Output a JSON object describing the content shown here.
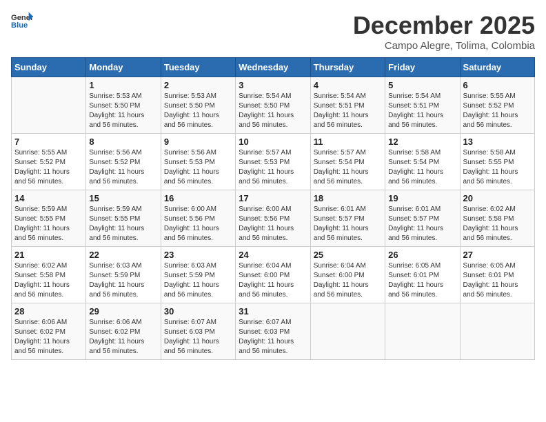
{
  "header": {
    "logo_general": "General",
    "logo_blue": "Blue",
    "month_title": "December 2025",
    "subtitle": "Campo Alegre, Tolima, Colombia"
  },
  "calendar": {
    "days_of_week": [
      "Sunday",
      "Monday",
      "Tuesday",
      "Wednesday",
      "Thursday",
      "Friday",
      "Saturday"
    ],
    "weeks": [
      [
        {
          "day": "",
          "info": ""
        },
        {
          "day": "1",
          "info": "Sunrise: 5:53 AM\nSunset: 5:50 PM\nDaylight: 11 hours\nand 56 minutes."
        },
        {
          "day": "2",
          "info": "Sunrise: 5:53 AM\nSunset: 5:50 PM\nDaylight: 11 hours\nand 56 minutes."
        },
        {
          "day": "3",
          "info": "Sunrise: 5:54 AM\nSunset: 5:50 PM\nDaylight: 11 hours\nand 56 minutes."
        },
        {
          "day": "4",
          "info": "Sunrise: 5:54 AM\nSunset: 5:51 PM\nDaylight: 11 hours\nand 56 minutes."
        },
        {
          "day": "5",
          "info": "Sunrise: 5:54 AM\nSunset: 5:51 PM\nDaylight: 11 hours\nand 56 minutes."
        },
        {
          "day": "6",
          "info": "Sunrise: 5:55 AM\nSunset: 5:52 PM\nDaylight: 11 hours\nand 56 minutes."
        }
      ],
      [
        {
          "day": "7",
          "info": "Sunrise: 5:55 AM\nSunset: 5:52 PM\nDaylight: 11 hours\nand 56 minutes."
        },
        {
          "day": "8",
          "info": "Sunrise: 5:56 AM\nSunset: 5:52 PM\nDaylight: 11 hours\nand 56 minutes."
        },
        {
          "day": "9",
          "info": "Sunrise: 5:56 AM\nSunset: 5:53 PM\nDaylight: 11 hours\nand 56 minutes."
        },
        {
          "day": "10",
          "info": "Sunrise: 5:57 AM\nSunset: 5:53 PM\nDaylight: 11 hours\nand 56 minutes."
        },
        {
          "day": "11",
          "info": "Sunrise: 5:57 AM\nSunset: 5:54 PM\nDaylight: 11 hours\nand 56 minutes."
        },
        {
          "day": "12",
          "info": "Sunrise: 5:58 AM\nSunset: 5:54 PM\nDaylight: 11 hours\nand 56 minutes."
        },
        {
          "day": "13",
          "info": "Sunrise: 5:58 AM\nSunset: 5:55 PM\nDaylight: 11 hours\nand 56 minutes."
        }
      ],
      [
        {
          "day": "14",
          "info": "Sunrise: 5:59 AM\nSunset: 5:55 PM\nDaylight: 11 hours\nand 56 minutes."
        },
        {
          "day": "15",
          "info": "Sunrise: 5:59 AM\nSunset: 5:55 PM\nDaylight: 11 hours\nand 56 minutes."
        },
        {
          "day": "16",
          "info": "Sunrise: 6:00 AM\nSunset: 5:56 PM\nDaylight: 11 hours\nand 56 minutes."
        },
        {
          "day": "17",
          "info": "Sunrise: 6:00 AM\nSunset: 5:56 PM\nDaylight: 11 hours\nand 56 minutes."
        },
        {
          "day": "18",
          "info": "Sunrise: 6:01 AM\nSunset: 5:57 PM\nDaylight: 11 hours\nand 56 minutes."
        },
        {
          "day": "19",
          "info": "Sunrise: 6:01 AM\nSunset: 5:57 PM\nDaylight: 11 hours\nand 56 minutes."
        },
        {
          "day": "20",
          "info": "Sunrise: 6:02 AM\nSunset: 5:58 PM\nDaylight: 11 hours\nand 56 minutes."
        }
      ],
      [
        {
          "day": "21",
          "info": "Sunrise: 6:02 AM\nSunset: 5:58 PM\nDaylight: 11 hours\nand 56 minutes."
        },
        {
          "day": "22",
          "info": "Sunrise: 6:03 AM\nSunset: 5:59 PM\nDaylight: 11 hours\nand 56 minutes."
        },
        {
          "day": "23",
          "info": "Sunrise: 6:03 AM\nSunset: 5:59 PM\nDaylight: 11 hours\nand 56 minutes."
        },
        {
          "day": "24",
          "info": "Sunrise: 6:04 AM\nSunset: 6:00 PM\nDaylight: 11 hours\nand 56 minutes."
        },
        {
          "day": "25",
          "info": "Sunrise: 6:04 AM\nSunset: 6:00 PM\nDaylight: 11 hours\nand 56 minutes."
        },
        {
          "day": "26",
          "info": "Sunrise: 6:05 AM\nSunset: 6:01 PM\nDaylight: 11 hours\nand 56 minutes."
        },
        {
          "day": "27",
          "info": "Sunrise: 6:05 AM\nSunset: 6:01 PM\nDaylight: 11 hours\nand 56 minutes."
        }
      ],
      [
        {
          "day": "28",
          "info": "Sunrise: 6:06 AM\nSunset: 6:02 PM\nDaylight: 11 hours\nand 56 minutes."
        },
        {
          "day": "29",
          "info": "Sunrise: 6:06 AM\nSunset: 6:02 PM\nDaylight: 11 hours\nand 56 minutes."
        },
        {
          "day": "30",
          "info": "Sunrise: 6:07 AM\nSunset: 6:03 PM\nDaylight: 11 hours\nand 56 minutes."
        },
        {
          "day": "31",
          "info": "Sunrise: 6:07 AM\nSunset: 6:03 PM\nDaylight: 11 hours\nand 56 minutes."
        },
        {
          "day": "",
          "info": ""
        },
        {
          "day": "",
          "info": ""
        },
        {
          "day": "",
          "info": ""
        }
      ]
    ]
  }
}
